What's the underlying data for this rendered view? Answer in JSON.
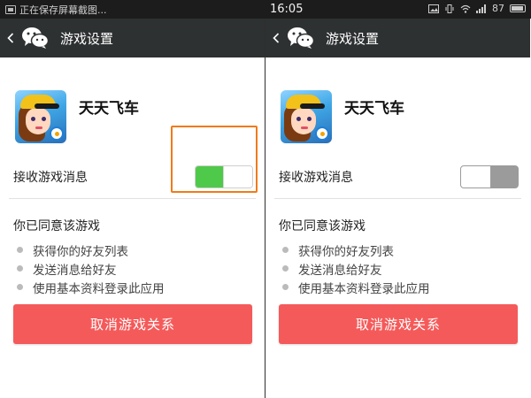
{
  "status_bar": {
    "notification_text": "正在保存屏幕截图...",
    "time": "16:05",
    "battery_level": "87"
  },
  "header": {
    "back_icon": "chevron-left-icon",
    "logo_icon": "wechat-logo-icon",
    "title": "游戏设置"
  },
  "game": {
    "name": "天天飞车",
    "icon": "game-app-icon"
  },
  "setting": {
    "label": "接收游戏消息"
  },
  "panels": [
    {
      "switch_state": "on"
    },
    {
      "switch_state": "off"
    }
  ],
  "permissions": {
    "title": "你已同意该游戏",
    "items": [
      "获得你的好友列表",
      "发送消息给好友",
      "使用基本资料登录此应用"
    ]
  },
  "cancel_button": {
    "label": "取消游戏关系"
  },
  "colors": {
    "header_bg": "#2e3132",
    "switch_on": "#4fc94a",
    "switch_off": "#9b9b9b",
    "button_bg": "#f55a5a",
    "highlight_border": "#f07b1a"
  }
}
